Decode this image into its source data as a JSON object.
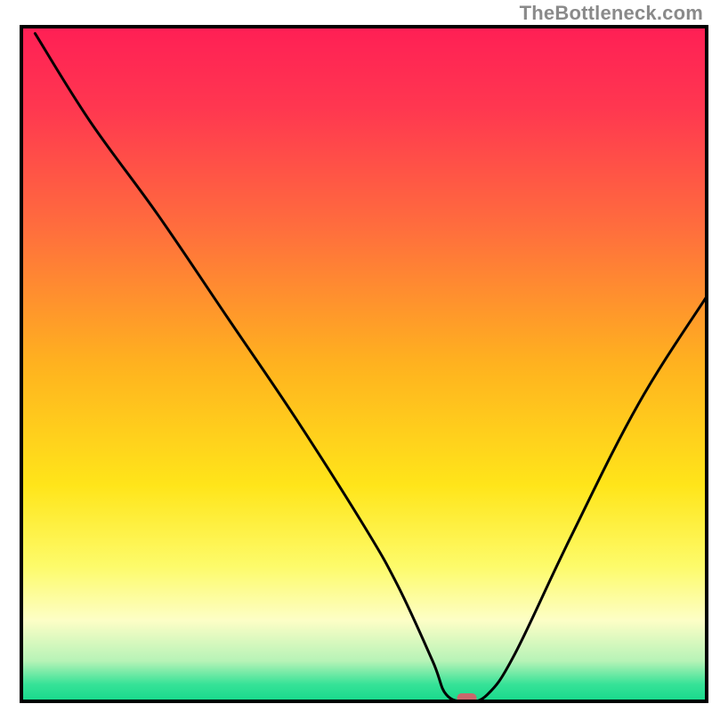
{
  "watermark": "TheBottleneck.com",
  "chart_data": {
    "type": "line",
    "title": "",
    "xlabel": "",
    "ylabel": "",
    "xlim": [
      0,
      100
    ],
    "ylim": [
      0,
      100
    ],
    "grid": false,
    "legend": false,
    "series": [
      {
        "name": "bottleneck-curve",
        "x": [
          2,
          10,
          20,
          30,
          40,
          50,
          55,
          60,
          62,
          65,
          68,
          72,
          80,
          90,
          100
        ],
        "y": [
          99,
          86,
          72,
          57,
          42,
          26,
          17,
          6,
          1,
          0,
          1,
          7,
          24,
          44,
          60
        ]
      }
    ],
    "marker": {
      "name": "optimal-marker",
      "x": 65,
      "y": 0,
      "color": "#c9686c",
      "shape": "rounded-pill"
    },
    "background_gradient": {
      "stops": [
        {
          "offset": 0.0,
          "color": "#ff1f55"
        },
        {
          "offset": 0.12,
          "color": "#ff3750"
        },
        {
          "offset": 0.3,
          "color": "#ff6e3d"
        },
        {
          "offset": 0.5,
          "color": "#ffb21f"
        },
        {
          "offset": 0.68,
          "color": "#ffe51a"
        },
        {
          "offset": 0.8,
          "color": "#fdfb6a"
        },
        {
          "offset": 0.88,
          "color": "#fdfec6"
        },
        {
          "offset": 0.94,
          "color": "#b7f3b7"
        },
        {
          "offset": 0.975,
          "color": "#36e297"
        },
        {
          "offset": 1.0,
          "color": "#17d98c"
        }
      ]
    },
    "frame_color": "#000000",
    "frame_stroke_width": 4,
    "curve_stroke_width": 3
  }
}
